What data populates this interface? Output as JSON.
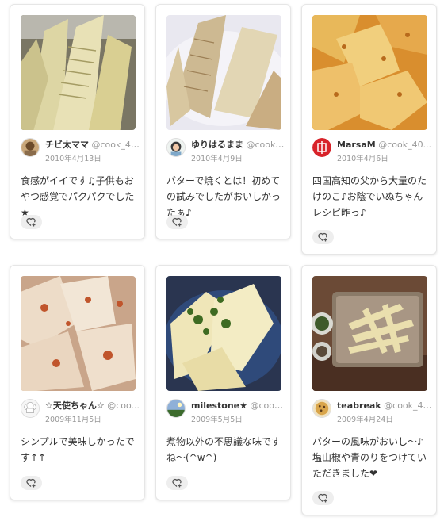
{
  "cards": [
    {
      "user": "チビ太ママ",
      "id": "@cook_40...",
      "date": "2010年4月13日",
      "text": "食感がイイです♫子供もおやつ感覚でパクパクでした★",
      "avatar_icon": "user-avatar-icon",
      "like_icon": "heart-plus-icon"
    },
    {
      "user": "ゆりはるまま",
      "id": "@cook_4...",
      "date": "2010年4月9日",
      "text": "バターで焼くとは！初めての試みでしたがおいしかったぁ♪",
      "avatar_icon": "user-avatar-icon",
      "like_icon": "heart-plus-icon"
    },
    {
      "user": "MarsaM",
      "id": "@cook_40...",
      "date": "2010年4月6日",
      "text": "四国高知の父から大量のたけのこ♪お陰でいぬちゃんレシピ昨っ♪",
      "avatar_icon": "user-avatar-icon",
      "like_icon": "heart-plus-icon"
    },
    {
      "user": "☆天使ちゃん☆",
      "id": "@coo...",
      "date": "2009年11月5日",
      "text": "シンプルで美味しかったです↑↑",
      "avatar_icon": "chef-hat-avatar-icon",
      "like_icon": "heart-plus-icon"
    },
    {
      "user": "milestone★",
      "id": "@cook_...",
      "date": "2009年5月5日",
      "text": "煮物以外の不思議な味ですね～(^w^)",
      "avatar_icon": "user-avatar-icon",
      "like_icon": "heart-plus-icon"
    },
    {
      "user": "teabreak",
      "id": "@cook_40...",
      "date": "2009年4月24日",
      "text": "バターの風味がおいし～♪塩山椒や青のりをつけていただきました❤",
      "avatar_icon": "user-avatar-icon",
      "like_icon": "heart-plus-icon"
    }
  ]
}
